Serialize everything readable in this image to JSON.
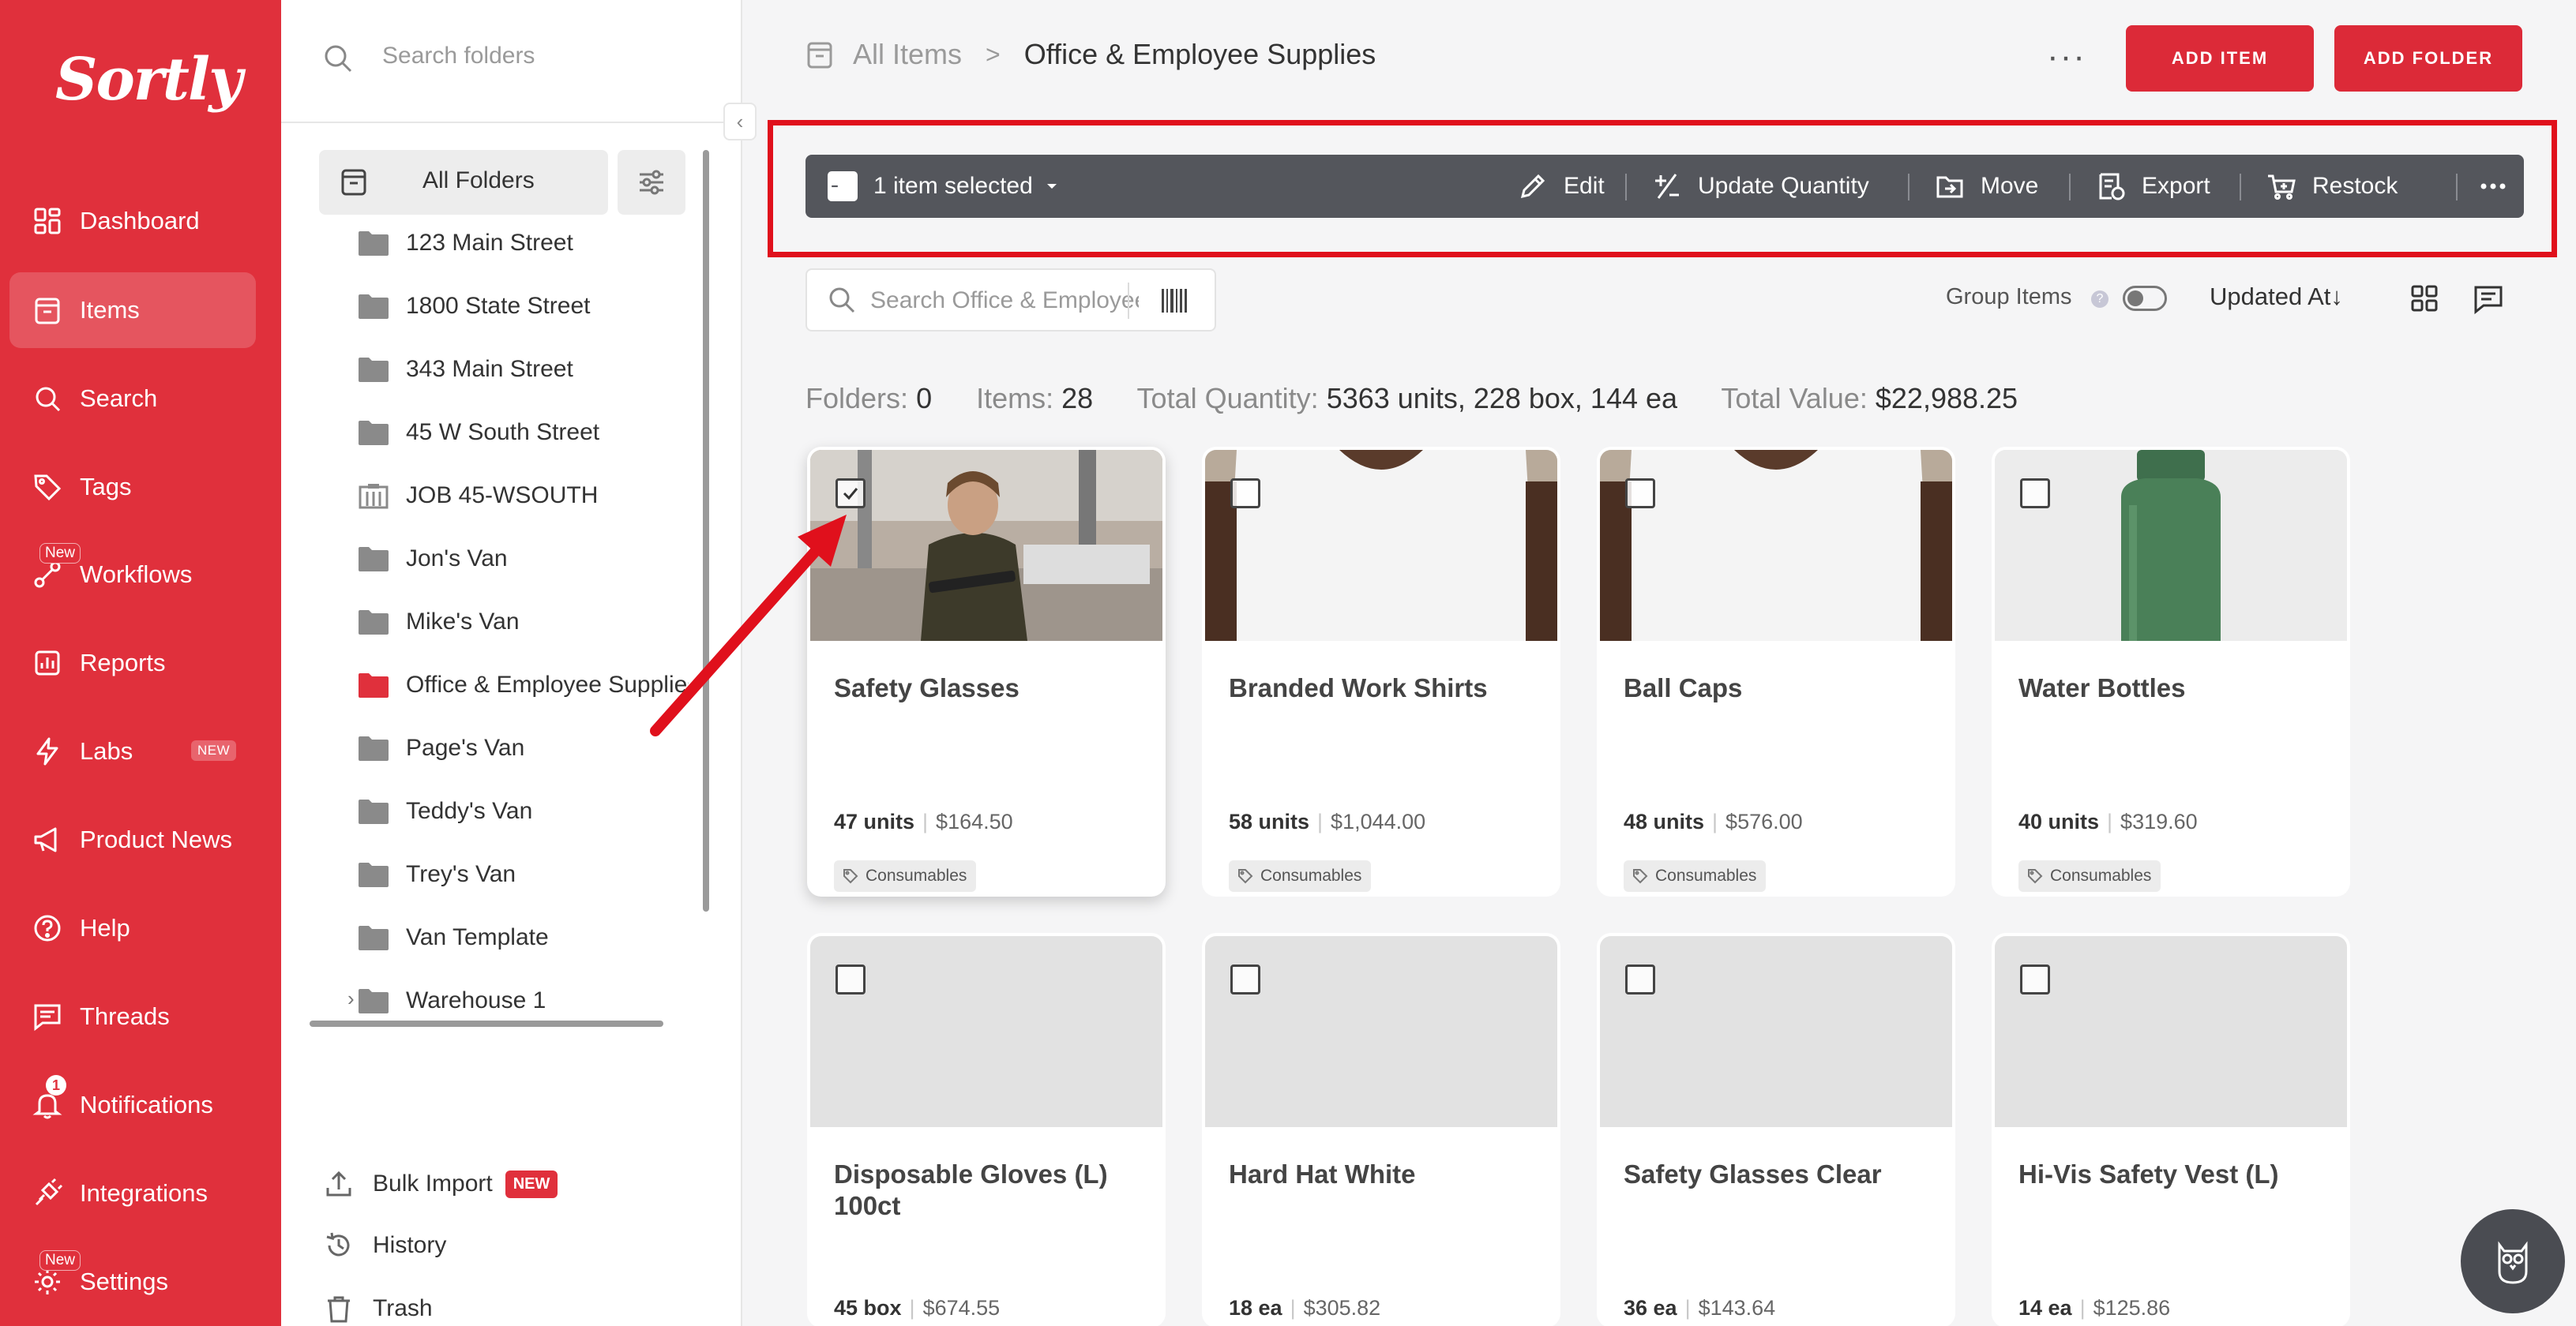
{
  "app": {
    "logo": "Sortly"
  },
  "nav": {
    "items": [
      {
        "label": "Dashboard",
        "icon": "dashboard-icon"
      },
      {
        "label": "Items",
        "icon": "items-icon",
        "active": true
      },
      {
        "label": "Search",
        "icon": "search-icon"
      },
      {
        "label": "Tags",
        "icon": "tag-icon"
      },
      {
        "label": "Workflows",
        "icon": "workflow-icon",
        "badge": "New"
      },
      {
        "label": "Reports",
        "icon": "reports-icon"
      },
      {
        "label": "Labs",
        "icon": "lightning-icon",
        "badge": "NEW"
      },
      {
        "label": "Product News",
        "icon": "megaphone-icon"
      },
      {
        "label": "Help",
        "icon": "help-icon"
      },
      {
        "label": "Threads",
        "icon": "threads-icon"
      },
      {
        "label": "Notifications",
        "icon": "bell-icon",
        "badge": "1"
      },
      {
        "label": "Integrations",
        "icon": "plug-icon"
      },
      {
        "label": "Settings",
        "icon": "gear-icon",
        "badge": "New"
      }
    ]
  },
  "folders": {
    "search_placeholder": "Search folders",
    "all_label": "All Folders",
    "items": [
      {
        "name": "123 Main Street"
      },
      {
        "name": "1800 State Street"
      },
      {
        "name": "343 Main Street"
      },
      {
        "name": "45 W South Street"
      },
      {
        "name": "JOB 45-WSOUTH"
      },
      {
        "name": "Jon's Van"
      },
      {
        "name": "Mike's Van"
      },
      {
        "name": "Office & Employee Supplies"
      },
      {
        "name": "Page's Van"
      },
      {
        "name": "Teddy's Van"
      },
      {
        "name": "Trey's Van"
      },
      {
        "name": "Van Template"
      },
      {
        "name": "Warehouse 1"
      }
    ],
    "bulk_import": "Bulk Import",
    "bulk_import_badge": "NEW",
    "history": "History",
    "trash": "Trash"
  },
  "breadcrumb": {
    "root": "All Items",
    "separator": ">",
    "current": "Office & Employee Supplies"
  },
  "header": {
    "add_item": "ADD ITEM",
    "add_folder": "ADD FOLDER"
  },
  "selection_bar": {
    "selected_label": "1 item selected",
    "edit": "Edit",
    "update_quantity": "Update Quantity",
    "move": "Move",
    "export": "Export",
    "restock": "Restock"
  },
  "toolbar": {
    "search_placeholder": "Search Office & Employee Supplies",
    "group_items": "Group Items",
    "help": "?",
    "sort_label": "Updated At",
    "sort_arrow": "↓"
  },
  "summary": {
    "folders_label": "Folders:",
    "folders_value": "0",
    "items_label": "Items:",
    "items_value": "28",
    "qty_label": "Total Quantity:",
    "qty_value": "5363 units, 228 box, 144 ea",
    "value_label": "Total Value:",
    "value_value": "$22,988.25"
  },
  "cards": [
    {
      "name": "Safety Glasses",
      "qty": "47 units",
      "price": "$164.50",
      "tag": "Consumables",
      "selected": true
    },
    {
      "name": "Branded Work Shirts",
      "qty": "58 units",
      "price": "$1,044.00",
      "tag": "Consumables"
    },
    {
      "name": "Ball Caps",
      "qty": "48 units",
      "price": "$576.00",
      "tag": "Consumables"
    },
    {
      "name": "Water Bottles",
      "qty": "40 units",
      "price": "$319.60",
      "tag": "Consumables"
    },
    {
      "name": "Disposable Gloves (L) 100ct",
      "qty": "45 box",
      "price": "$674.55"
    },
    {
      "name": "Hard Hat White",
      "qty": "18 ea",
      "price": "$305.82"
    },
    {
      "name": "Safety Glasses Clear",
      "qty": "36 ea",
      "price": "$143.64"
    },
    {
      "name": "Hi-Vis Safety Vest (L)",
      "qty": "14 ea",
      "price": "$125.86"
    }
  ],
  "colors": {
    "brand_red": "#e0303c",
    "action_bar": "#54565c",
    "highlight": "#e0101c"
  }
}
